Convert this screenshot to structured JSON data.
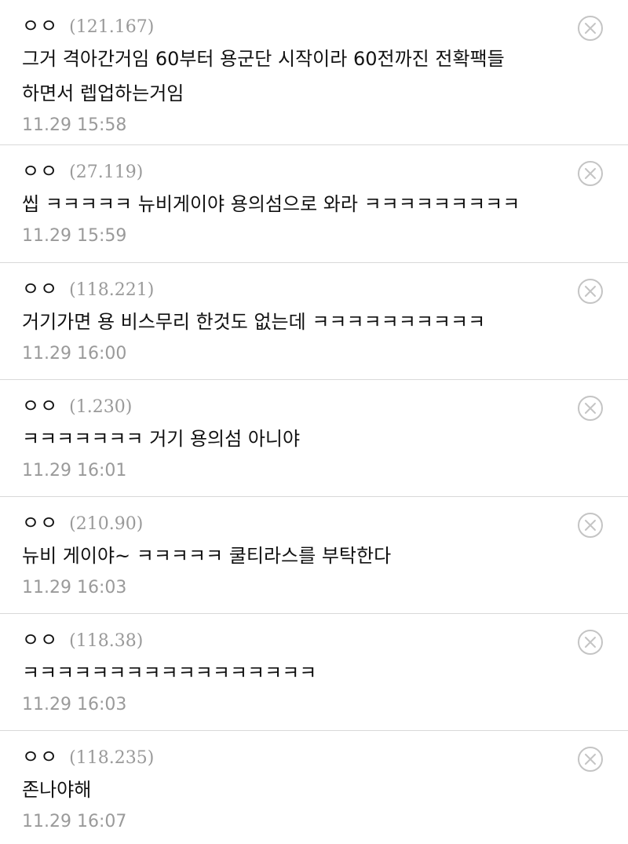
{
  "comments": [
    {
      "nickname": "ㅇㅇ",
      "ip": "(121.167)",
      "text": "그거 격아간거임 60부터 용군단 시작이라 60전까진 전확팩들 하면서 렙업하는거임",
      "time": "11.29 15:58"
    },
    {
      "nickname": "ㅇㅇ",
      "ip": "(27.119)",
      "text": "씹 ㅋㅋㅋㅋㅋ 뉴비게이야 용의섬으로 와라 ㅋㅋㅋㅋㅋㅋㅋㅋㅋ",
      "time": "11.29 15:59"
    },
    {
      "nickname": "ㅇㅇ",
      "ip": "(118.221)",
      "text": "거기가면 용 비스무리 한것도 없는데 ㅋㅋㅋㅋㅋㅋㅋㅋㅋㅋ",
      "time": "11.29 16:00"
    },
    {
      "nickname": "ㅇㅇ",
      "ip": "(1.230)",
      "text": "ㅋㅋㅋㅋㅋㅋㅋ 거기 용의섬 아니야",
      "time": "11.29 16:01"
    },
    {
      "nickname": "ㅇㅇ",
      "ip": "(210.90)",
      "text": "뉴비 게이야~ ㅋㅋㅋㅋㅋ 쿨티라스를 부탁한다",
      "time": "11.29 16:03"
    },
    {
      "nickname": "ㅇㅇ",
      "ip": "(118.38)",
      "text": "ㅋㅋㅋㅋㅋㅋㅋㅋㅋㅋㅋㅋㅋㅋㅋㅋㅋ",
      "time": "11.29 16:03"
    },
    {
      "nickname": "ㅇㅇ",
      "ip": "(118.235)",
      "text": "존나야해",
      "time": "11.29 16:07"
    }
  ],
  "icons": {
    "delete": "close-circle-icon"
  },
  "colors": {
    "text": "#111111",
    "meta": "#9a9a9a",
    "divider": "#d9d9d9",
    "icon": "#c4c4c4"
  }
}
